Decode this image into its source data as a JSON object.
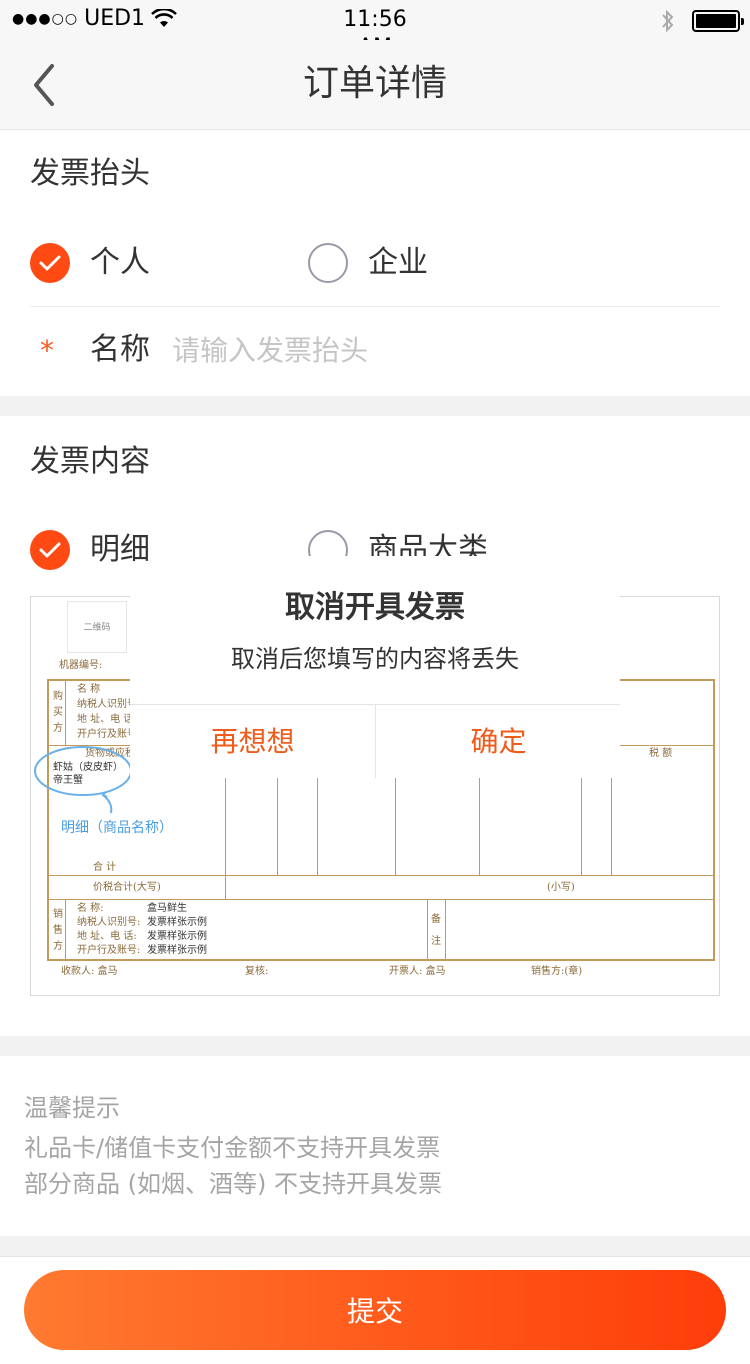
{
  "status_bar": {
    "carrier": "UED1",
    "time": "11:56\nAM"
  },
  "nav": {
    "title": "订单详情",
    "back_icon": "chevron-left-icon"
  },
  "invoice_header": {
    "title": "发票抬头",
    "options": [
      {
        "label": "个人",
        "selected": true
      },
      {
        "label": "企业",
        "selected": false
      }
    ],
    "required_mark": "*",
    "name_label": "名称",
    "name_placeholder": "请输入发票抬头",
    "name_value": ""
  },
  "invoice_content": {
    "title": "发票内容",
    "options": [
      {
        "label": "明细",
        "selected": true
      },
      {
        "label": "商品大类",
        "selected": false
      }
    ]
  },
  "invoice_sample": {
    "qr_label": "二维码",
    "machine_no": "机器编号:",
    "buyer_side": "购买方",
    "buyer_fields": [
      "名 称",
      "纳税人识别号:",
      "地 址、电 话",
      "开户行及账号"
    ],
    "goods_header": "货物或应税劳务",
    "items": [
      "虾姑（皮皮虾）",
      "帝王蟹"
    ],
    "tax_header": "税 额",
    "annotation": "明细（商品名称）",
    "total_label": "合 计",
    "total_tax_label": "价税合计(大写)",
    "small_write": "(小写)",
    "seller_side": "销售方",
    "seller_fields": [
      {
        "label": "名 称:",
        "value": "盒马鲜生"
      },
      {
        "label": "纳税人识别号:",
        "value": "发票样张示例"
      },
      {
        "label": "地 址、电 话:",
        "value": "发票样张示例"
      },
      {
        "label": "开户行及账号:",
        "value": "发票样张示例"
      }
    ],
    "remark": "备注",
    "payee": "收款人: 盒马",
    "reviewer": "复核:",
    "issuer": "开票人: 盒马",
    "seller_stamp": "销售方:(章)"
  },
  "dialog": {
    "title": "取消开具发票",
    "message": "取消后您填写的内容将丢失",
    "cancel_label": "再想想",
    "confirm_label": "确定"
  },
  "tips": {
    "title": "温馨提示",
    "lines": [
      "礼品卡/储值卡支付金额不支持开具发票",
      "部分商品 (如烟、酒等) 不支持开具发票"
    ]
  },
  "submit_label": "提交",
  "colors": {
    "accent": "#ff4a14",
    "dialog_button": "#f05a1a",
    "submit_gradient_start": "#ff7a30",
    "submit_gradient_end": "#ff3d0a"
  }
}
